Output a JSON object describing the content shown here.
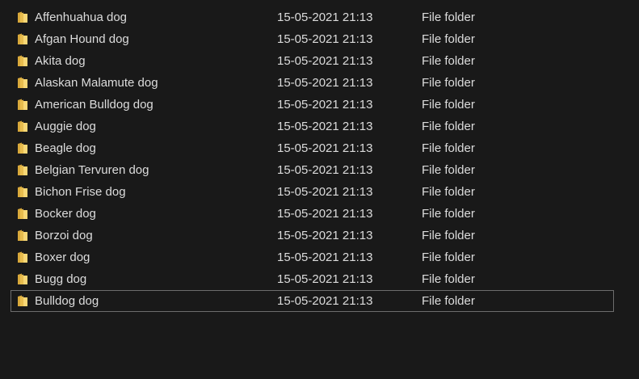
{
  "files": [
    {
      "name": "Affenhuahua dog",
      "date_modified": "15-05-2021 21:13",
      "type": "File folder",
      "icon": "folder-icon"
    },
    {
      "name": "Afgan Hound dog",
      "date_modified": "15-05-2021 21:13",
      "type": "File folder",
      "icon": "folder-icon"
    },
    {
      "name": "Akita dog",
      "date_modified": "15-05-2021 21:13",
      "type": "File folder",
      "icon": "folder-icon"
    },
    {
      "name": "Alaskan Malamute dog",
      "date_modified": "15-05-2021 21:13",
      "type": "File folder",
      "icon": "folder-icon"
    },
    {
      "name": "American Bulldog dog",
      "date_modified": "15-05-2021 21:13",
      "type": "File folder",
      "icon": "folder-icon"
    },
    {
      "name": "Auggie dog",
      "date_modified": "15-05-2021 21:13",
      "type": "File folder",
      "icon": "folder-icon"
    },
    {
      "name": "Beagle dog",
      "date_modified": "15-05-2021 21:13",
      "type": "File folder",
      "icon": "folder-icon"
    },
    {
      "name": "Belgian Tervuren dog",
      "date_modified": "15-05-2021 21:13",
      "type": "File folder",
      "icon": "folder-icon"
    },
    {
      "name": "Bichon Frise dog",
      "date_modified": "15-05-2021 21:13",
      "type": "File folder",
      "icon": "folder-icon"
    },
    {
      "name": "Bocker dog",
      "date_modified": "15-05-2021 21:13",
      "type": "File folder",
      "icon": "folder-icon"
    },
    {
      "name": "Borzoi dog",
      "date_modified": "15-05-2021 21:13",
      "type": "File folder",
      "icon": "folder-icon"
    },
    {
      "name": "Boxer dog",
      "date_modified": "15-05-2021 21:13",
      "type": "File folder",
      "icon": "folder-icon"
    },
    {
      "name": "Bugg dog",
      "date_modified": "15-05-2021 21:13",
      "type": "File folder",
      "icon": "folder-icon"
    },
    {
      "name": "Bulldog dog",
      "date_modified": "15-05-2021 21:13",
      "type": "File folder",
      "icon": "folder-icon"
    }
  ],
  "focused_row": 13,
  "colors": {
    "background": "#191919",
    "text": "#dcdcdc",
    "folder_fill": "#f8d775",
    "folder_dark": "#d9a93b",
    "focus_border": "#6d6d6d"
  }
}
